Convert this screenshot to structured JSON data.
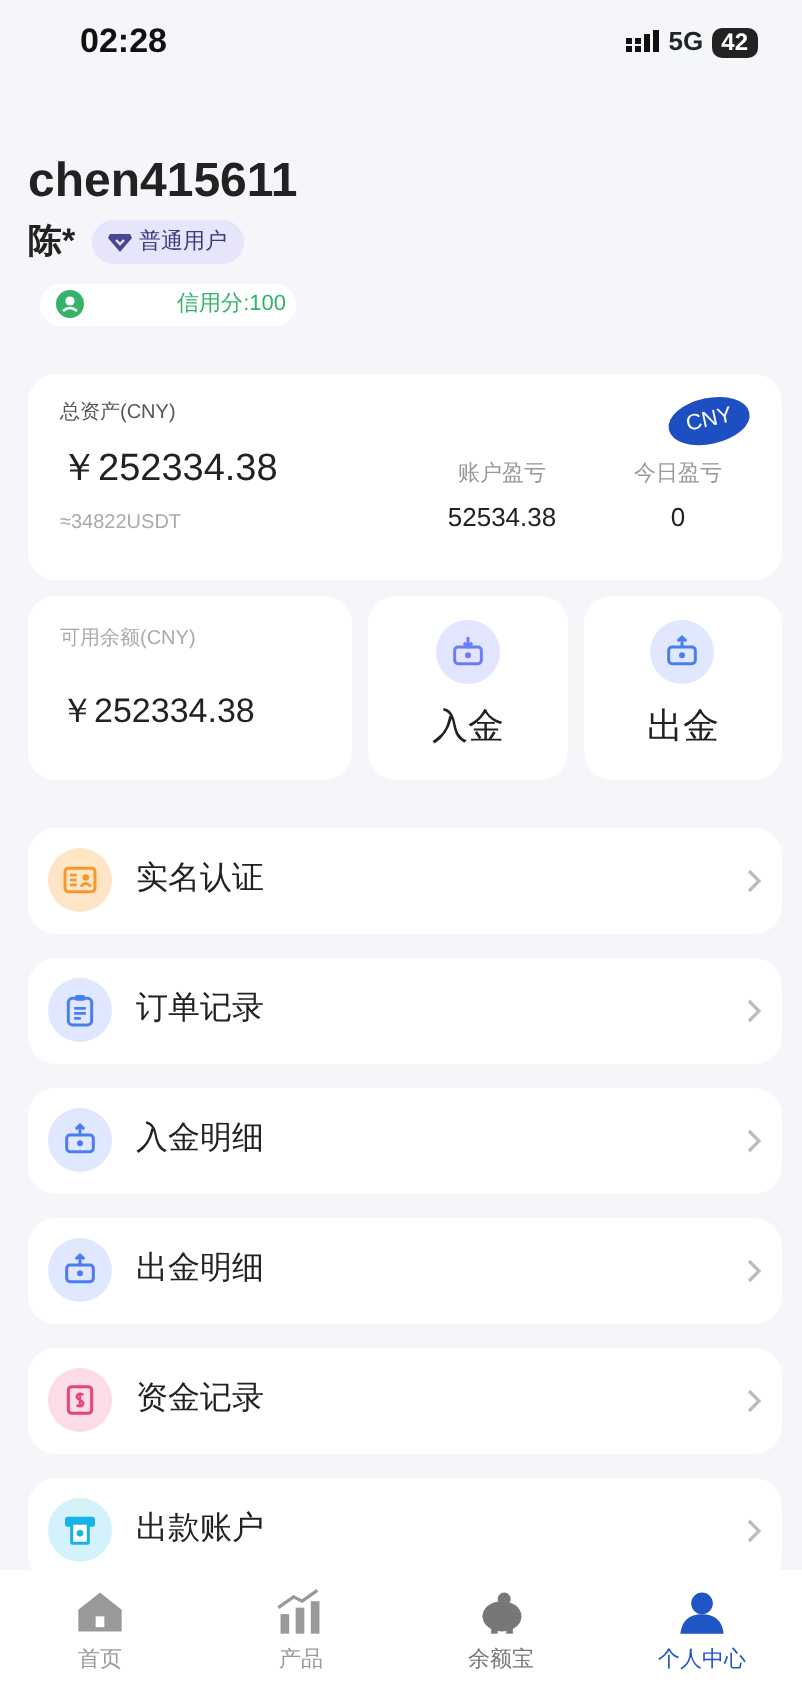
{
  "status_bar": {
    "time": "02:28",
    "network": "5G",
    "battery": "42"
  },
  "profile": {
    "username": "chen415611",
    "name": "陈*",
    "level": "普通用户",
    "credit": "信用分:100"
  },
  "assets": {
    "label": "总资产(CNY)",
    "currency": "CNY",
    "total": "￥252334.38",
    "usdt": "≈34822USDT",
    "stats": [
      {
        "label": "账户盈亏",
        "value": "52534.38"
      },
      {
        "label": "今日盈亏",
        "value": "0"
      }
    ]
  },
  "balance": {
    "label": "可用余额(CNY)",
    "amount": "￥252334.38"
  },
  "actions": [
    {
      "label": "入金",
      "kind": "deposit"
    },
    {
      "label": "出金",
      "kind": "withdraw"
    }
  ],
  "menu": [
    {
      "label": "实名认证",
      "kind": "id-card"
    },
    {
      "label": "订单记录",
      "kind": "clipboard"
    },
    {
      "label": "入金明细",
      "kind": "withdraw"
    },
    {
      "label": "出金明细",
      "kind": "withdraw"
    },
    {
      "label": "资金记录",
      "kind": "money"
    },
    {
      "label": "出款账户",
      "kind": "atm"
    }
  ],
  "tabs": [
    {
      "label": "首页",
      "kind": "home",
      "selected": false
    },
    {
      "label": "产品",
      "kind": "chart",
      "selected": false
    },
    {
      "label": "余额宝",
      "kind": "piggy",
      "selected": false
    },
    {
      "label": "个人中心",
      "kind": "person",
      "selected": true
    }
  ]
}
